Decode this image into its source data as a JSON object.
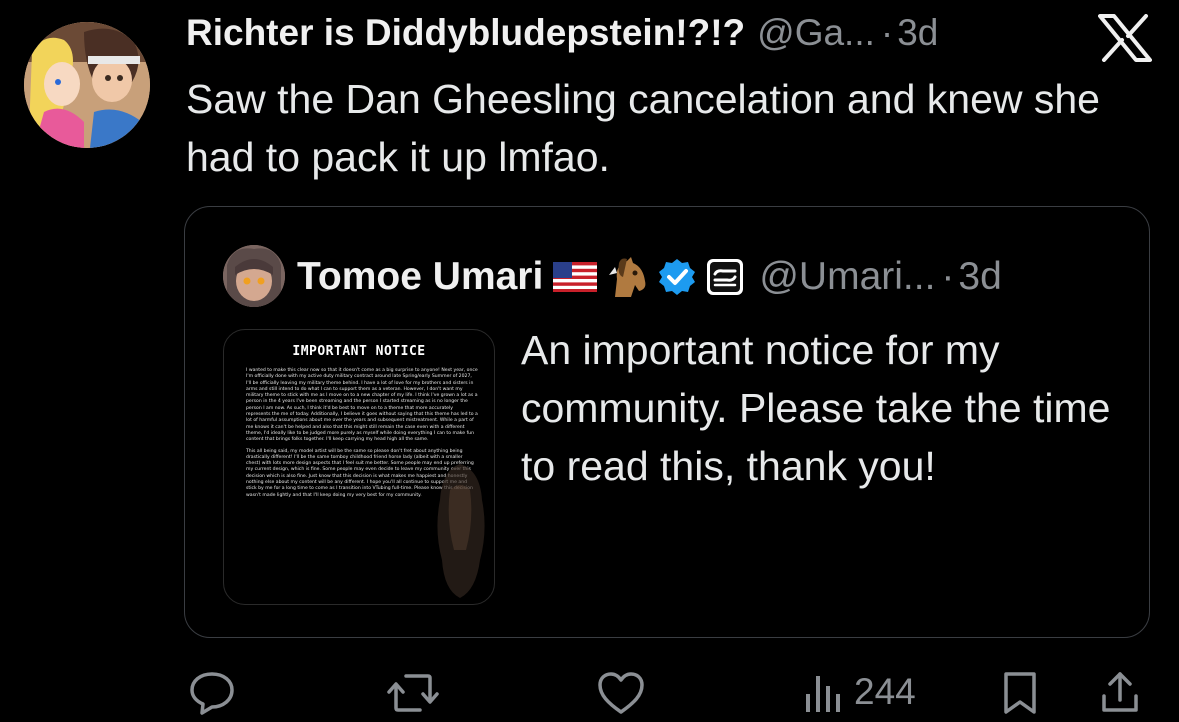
{
  "tweet": {
    "display_name": "Richter is Diddybludepstein!?!?",
    "handle": "@Ga...",
    "dot": "·",
    "time": "3d",
    "text": "Saw the Dan Gheesling cancelation and knew she had to pack it up lmfao."
  },
  "quote": {
    "display_name": "Tomoe Umari",
    "badges": [
      "us-flag-emoji",
      "horse-emoji",
      "verified-badge-icon",
      "affiliate-badge-icon"
    ],
    "handle": "@Umari...",
    "dot": "·",
    "time": "3d",
    "text": "An important notice for my community. Please take the time to read this, thank you!",
    "notice_image": {
      "title": "IMPORTANT NOTICE",
      "paragraphs": [
        "I wanted to make this clear now so that it doesn't come as a big surprise to anyone! Next year, once I'm officially done with my active duty military contract around late Spring/early Summer of 2027, I'll be officially leaving my military theme behind. I have a lot of love for my brothers and sisters in arms and still intend to do what I can to support them as a veteran. However, I don't want my military theme to stick with me as I move on to a new chapter of my life. I think I've grown a lot as a person in the 4 years I've been streaming and the person I started streaming as is no longer the person I am now. As such, I think it'd be best to move on to a theme that more accurately represents the me of today. Additionally, I believe it goes without saying that this theme has led to a lot of harmful assumptions about me over the years and subsequent mistreatment. While a part of me knows it can't be helped and also that this might still remain the case even with a different theme, I'd ideally like to be judged more purely as myself while doing everything I can to make fun content that brings folks together. I'll keep carrying my head high all the same.",
        "This all being said, my model artist will be the same so please don't fret about anything being drastically different! I'll be the same tomboy childhood friend horse lady (albeit with a smaller chest) with lots more design aspects that I feel suit me better. Some people may end up preferring my current design, which is fine. Some people may even decide to leave my community over this decision which is also fine. Just know that this decision is what makes me happiest and honestly nothing else about my content will be any different. I hope you'll all continue to support me and stick by me for a long time to come as I transition into VTubing full-time. Please know this decision wasn't made lightly and that I'll keep doing my very best for my community."
      ]
    }
  },
  "actions": {
    "reply_icon": "reply-icon",
    "retweet_icon": "retweet-icon",
    "like_icon": "heart-icon",
    "views_icon": "views-icon",
    "views_count": "244",
    "bookmark_icon": "bookmark-icon",
    "share_icon": "share-icon"
  },
  "colors": {
    "background": "#000000",
    "text": "#e7e9ea",
    "secondary": "#8b8f94",
    "verified": "#1d9bf0"
  }
}
